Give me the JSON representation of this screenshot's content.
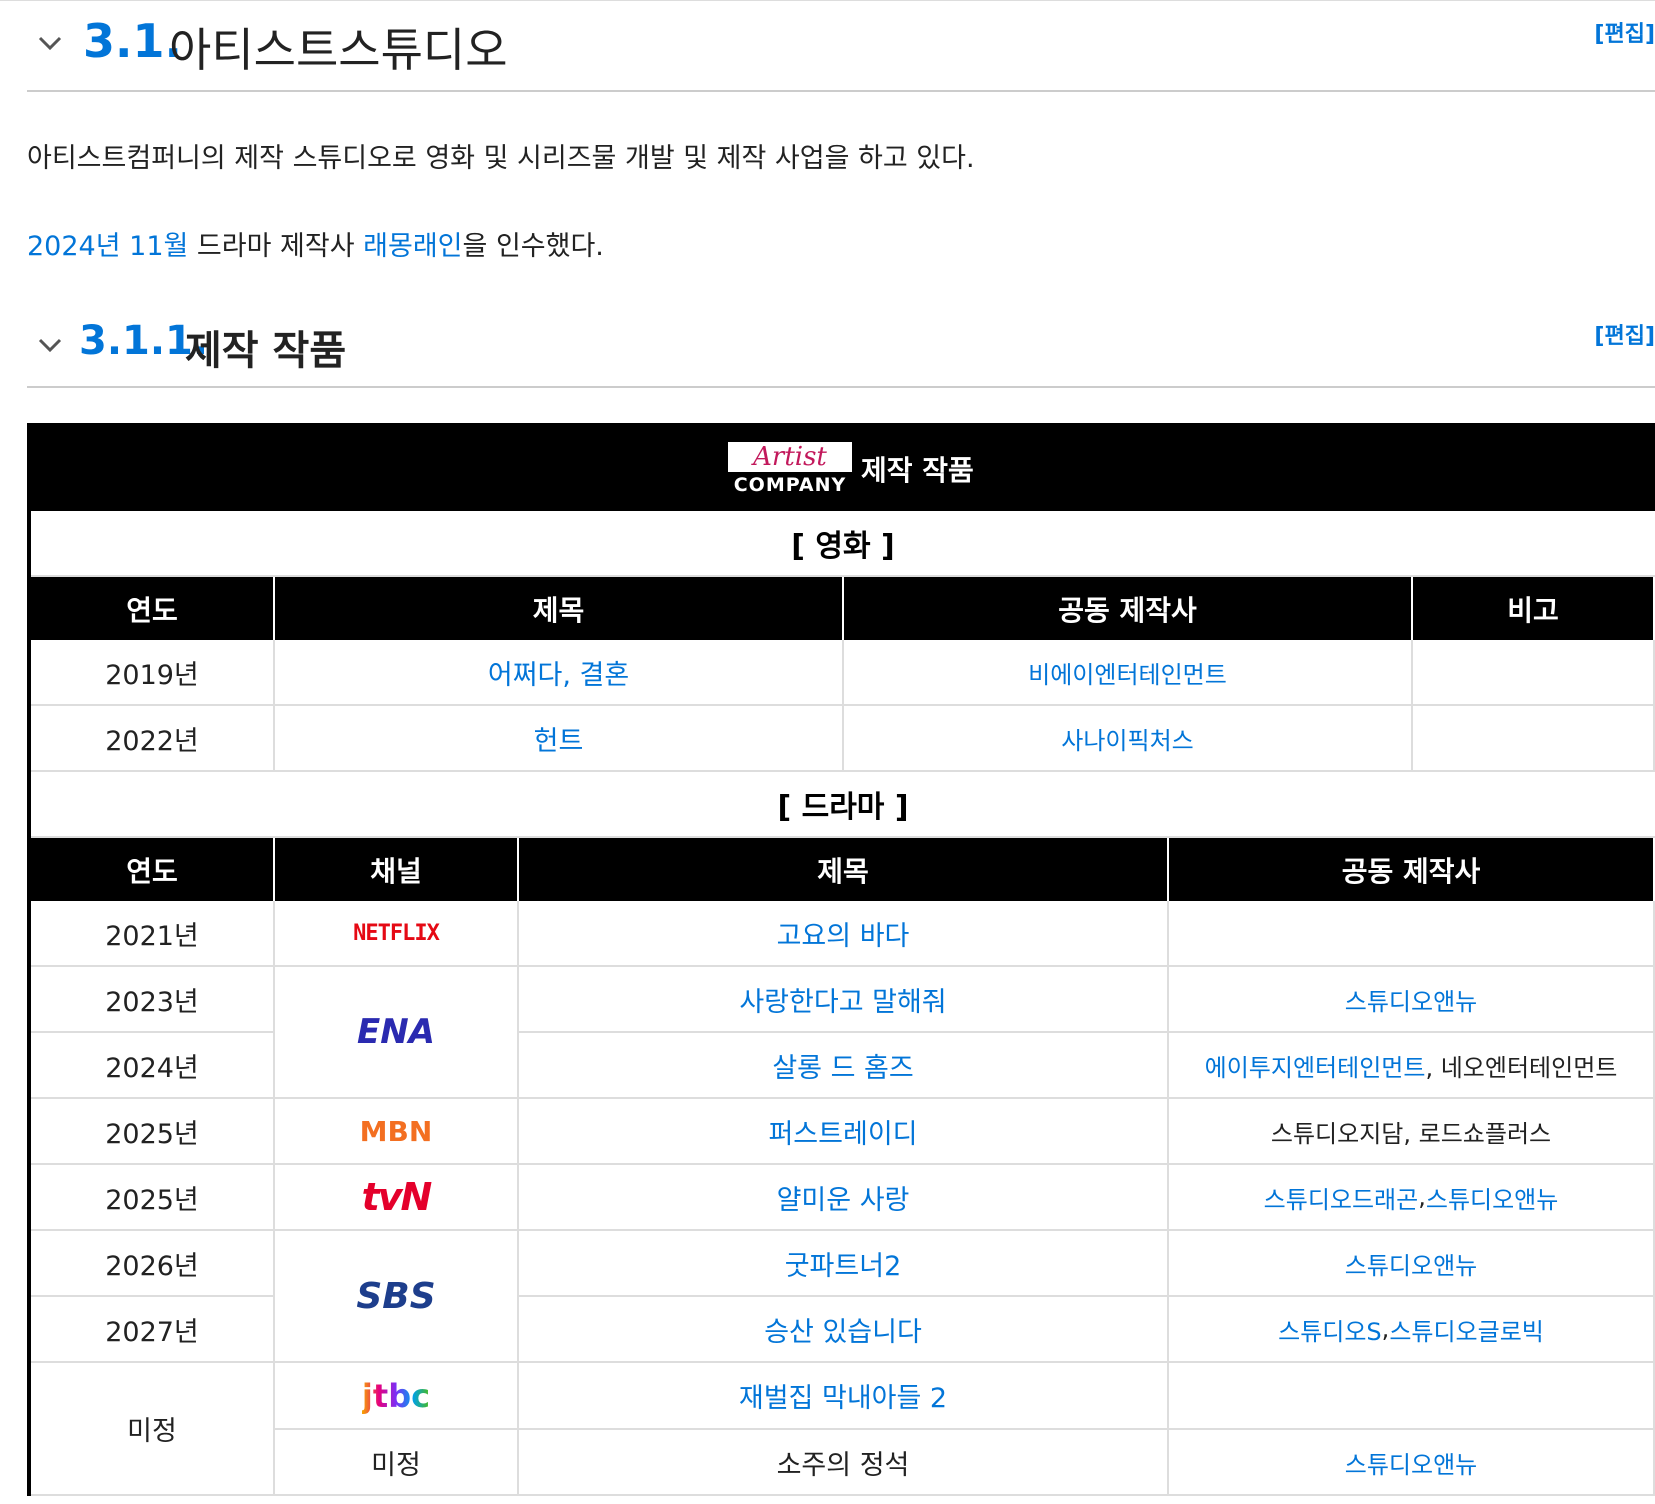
{
  "section1": {
    "number": "3.1.",
    "title": "아티스트스튜디오",
    "edit_label": "[편집]"
  },
  "paragraph1": "아티스트컴퍼니의 제작 스튜디오로 영화 및 시리즈물 개발 및 제작 사업을 하고 있다.",
  "paragraph2": {
    "date_link": "2024년 11월",
    "text_a": " 드라마 제작사 ",
    "company_link": "래몽래인",
    "text_b": "을 인수했다."
  },
  "section2": {
    "number": "3.1.1.",
    "title": "제작 작품",
    "edit_label": "[편집]"
  },
  "table": {
    "logo": {
      "script": "Artist",
      "band": "COMPANY"
    },
    "title": "제작 작품",
    "film": {
      "category": "[ 영화 ]",
      "headers": [
        "연도",
        "제목",
        "공동 제작사",
        "비고"
      ],
      "rows": [
        {
          "year": "2019년",
          "title": "어쩌다, 결혼",
          "coproducer": "비에이엔터테인먼트",
          "note": ""
        },
        {
          "year": "2022년",
          "title": "헌트",
          "coproducer": "사나이픽처스",
          "note": ""
        }
      ]
    },
    "drama": {
      "category": "[ 드라마 ]",
      "headers": [
        "연도",
        "채널",
        "제목",
        "공동 제작사"
      ],
      "rows": [
        {
          "year": "2021년",
          "channel": "NETFLIX",
          "title": "고요의 바다",
          "coproducer": ""
        },
        {
          "year": "2023년",
          "channel": "ENA",
          "title": "사랑한다고 말해줘",
          "coproducer": "스튜디오앤뉴"
        },
        {
          "year": "2024년",
          "channel": "ENA",
          "title": "살롱 드 홈즈",
          "coproducer_link": "에이투지엔터테인먼트",
          "coproducer_rest": ", 네오엔터테인먼트"
        },
        {
          "year": "2025년",
          "channel": "MBN",
          "title": "퍼스트레이디",
          "coproducer": "스튜디오지담, 로드쇼플러스"
        },
        {
          "year": "2025년",
          "channel": "tvN",
          "title": "얄미운 사랑",
          "coproducer_a": "스튜디오드래곤",
          "coproducer_sep": ", ",
          "coproducer_b": "스튜디오앤뉴"
        },
        {
          "year": "2026년",
          "channel": "SBS",
          "title": "굿파트너2",
          "coproducer": "스튜디오앤뉴"
        },
        {
          "year": "2027년",
          "channel": "SBS",
          "title": "승산 있습니다",
          "coproducer_a": "스튜디오S",
          "coproducer_sep": ", ",
          "coproducer_b": "스튜디오글로빅"
        },
        {
          "year": "미정",
          "channel": "jtbc",
          "title": "재벌집 막내아들 2",
          "coproducer": ""
        },
        {
          "year": "미정",
          "channel": "미정",
          "title": "소주의 정석",
          "coproducer": "스튜디오앤뉴"
        }
      ]
    }
  },
  "colors": {
    "link": "#0275d8",
    "netflix": "#e50914",
    "ena": "#2a2ab0",
    "mbn": "#f36f21",
    "tvn": "#e4002b",
    "sbs": "#1d3e8c"
  }
}
